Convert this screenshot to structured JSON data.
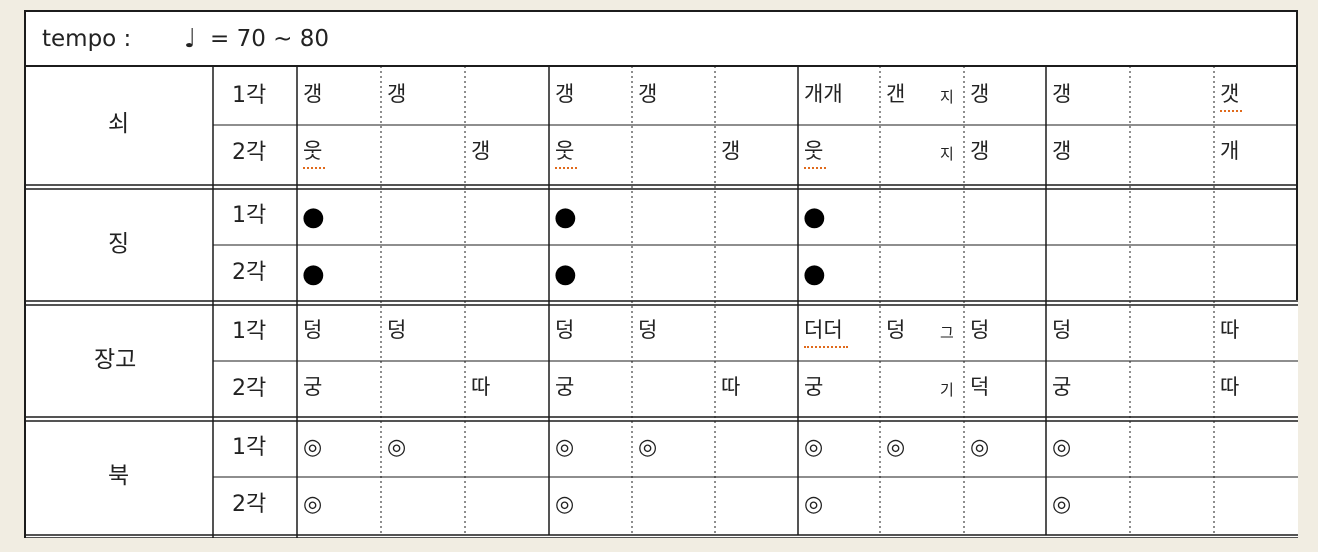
{
  "tempo": {
    "label": "tempo :",
    "note_symbol": "♩",
    "value": "= 70 ~ 80"
  },
  "gak_labels": [
    "1각",
    "2각"
  ],
  "mark_legend": {
    "dot": "●",
    "ring": "◎"
  },
  "sections": [
    {
      "name": "쇠",
      "rows": [
        {
          "gak": "1각",
          "cells": [
            {
              "col": 0,
              "text": "갱"
            },
            {
              "col": 1,
              "text": "갱"
            },
            {
              "col": 3,
              "text": "갱"
            },
            {
              "col": 4,
              "text": "갱"
            },
            {
              "col": 6,
              "text": "개개"
            },
            {
              "col": 7,
              "text": "갠"
            },
            {
              "col": 7,
              "text": "지",
              "small": true,
              "align": "right"
            },
            {
              "col": 8,
              "text": "갱"
            },
            {
              "col": 9,
              "text": "갱"
            },
            {
              "col": 11,
              "text": "갯",
              "underline": true
            }
          ]
        },
        {
          "gak": "2각",
          "cells": [
            {
              "col": 0,
              "text": "웃",
              "underline": true
            },
            {
              "col": 2,
              "text": "갱"
            },
            {
              "col": 3,
              "text": "웃",
              "underline": true
            },
            {
              "col": 5,
              "text": "갱"
            },
            {
              "col": 6,
              "text": "웃",
              "underline": true
            },
            {
              "col": 7,
              "text": "지",
              "small": true,
              "align": "right"
            },
            {
              "col": 8,
              "text": "갱"
            },
            {
              "col": 9,
              "text": "갱"
            },
            {
              "col": 11,
              "text": "개"
            }
          ]
        }
      ]
    },
    {
      "name": "징",
      "rows": [
        {
          "gak": "1각",
          "cells": [
            {
              "col": 0,
              "mark": "dot"
            },
            {
              "col": 3,
              "mark": "dot"
            },
            {
              "col": 6,
              "mark": "dot"
            }
          ]
        },
        {
          "gak": "2각",
          "cells": [
            {
              "col": 0,
              "mark": "dot"
            },
            {
              "col": 3,
              "mark": "dot"
            },
            {
              "col": 6,
              "mark": "dot"
            }
          ]
        }
      ]
    },
    {
      "name": "장고",
      "rows": [
        {
          "gak": "1각",
          "cells": [
            {
              "col": 0,
              "text": "덩"
            },
            {
              "col": 1,
              "text": "덩"
            },
            {
              "col": 3,
              "text": "덩"
            },
            {
              "col": 4,
              "text": "덩"
            },
            {
              "col": 6,
              "text": "더더",
              "underline": true
            },
            {
              "col": 7,
              "text": "덩"
            },
            {
              "col": 7,
              "text": "그",
              "small": true,
              "align": "right"
            },
            {
              "col": 8,
              "text": "덩"
            },
            {
              "col": 9,
              "text": "덩"
            },
            {
              "col": 11,
              "text": "따"
            }
          ]
        },
        {
          "gak": "2각",
          "cells": [
            {
              "col": 0,
              "text": "궁"
            },
            {
              "col": 2,
              "text": "따"
            },
            {
              "col": 3,
              "text": "궁"
            },
            {
              "col": 5,
              "text": "따"
            },
            {
              "col": 6,
              "text": "궁"
            },
            {
              "col": 7,
              "text": "기",
              "small": true,
              "align": "right"
            },
            {
              "col": 8,
              "text": "덕"
            },
            {
              "col": 9,
              "text": "궁"
            },
            {
              "col": 11,
              "text": "따"
            }
          ]
        }
      ]
    },
    {
      "name": "북",
      "rows": [
        {
          "gak": "1각",
          "cells": [
            {
              "col": 0,
              "mark": "ring"
            },
            {
              "col": 1,
              "mark": "ring"
            },
            {
              "col": 3,
              "mark": "ring"
            },
            {
              "col": 4,
              "mark": "ring"
            },
            {
              "col": 6,
              "mark": "ring"
            },
            {
              "col": 7,
              "mark": "ring"
            },
            {
              "col": 8,
              "mark": "ring"
            },
            {
              "col": 9,
              "mark": "ring"
            }
          ]
        },
        {
          "gak": "2각",
          "cells": [
            {
              "col": 0,
              "mark": "ring"
            },
            {
              "col": 3,
              "mark": "ring"
            },
            {
              "col": 6,
              "mark": "ring"
            },
            {
              "col": 9,
              "mark": "ring"
            }
          ]
        }
      ]
    }
  ]
}
